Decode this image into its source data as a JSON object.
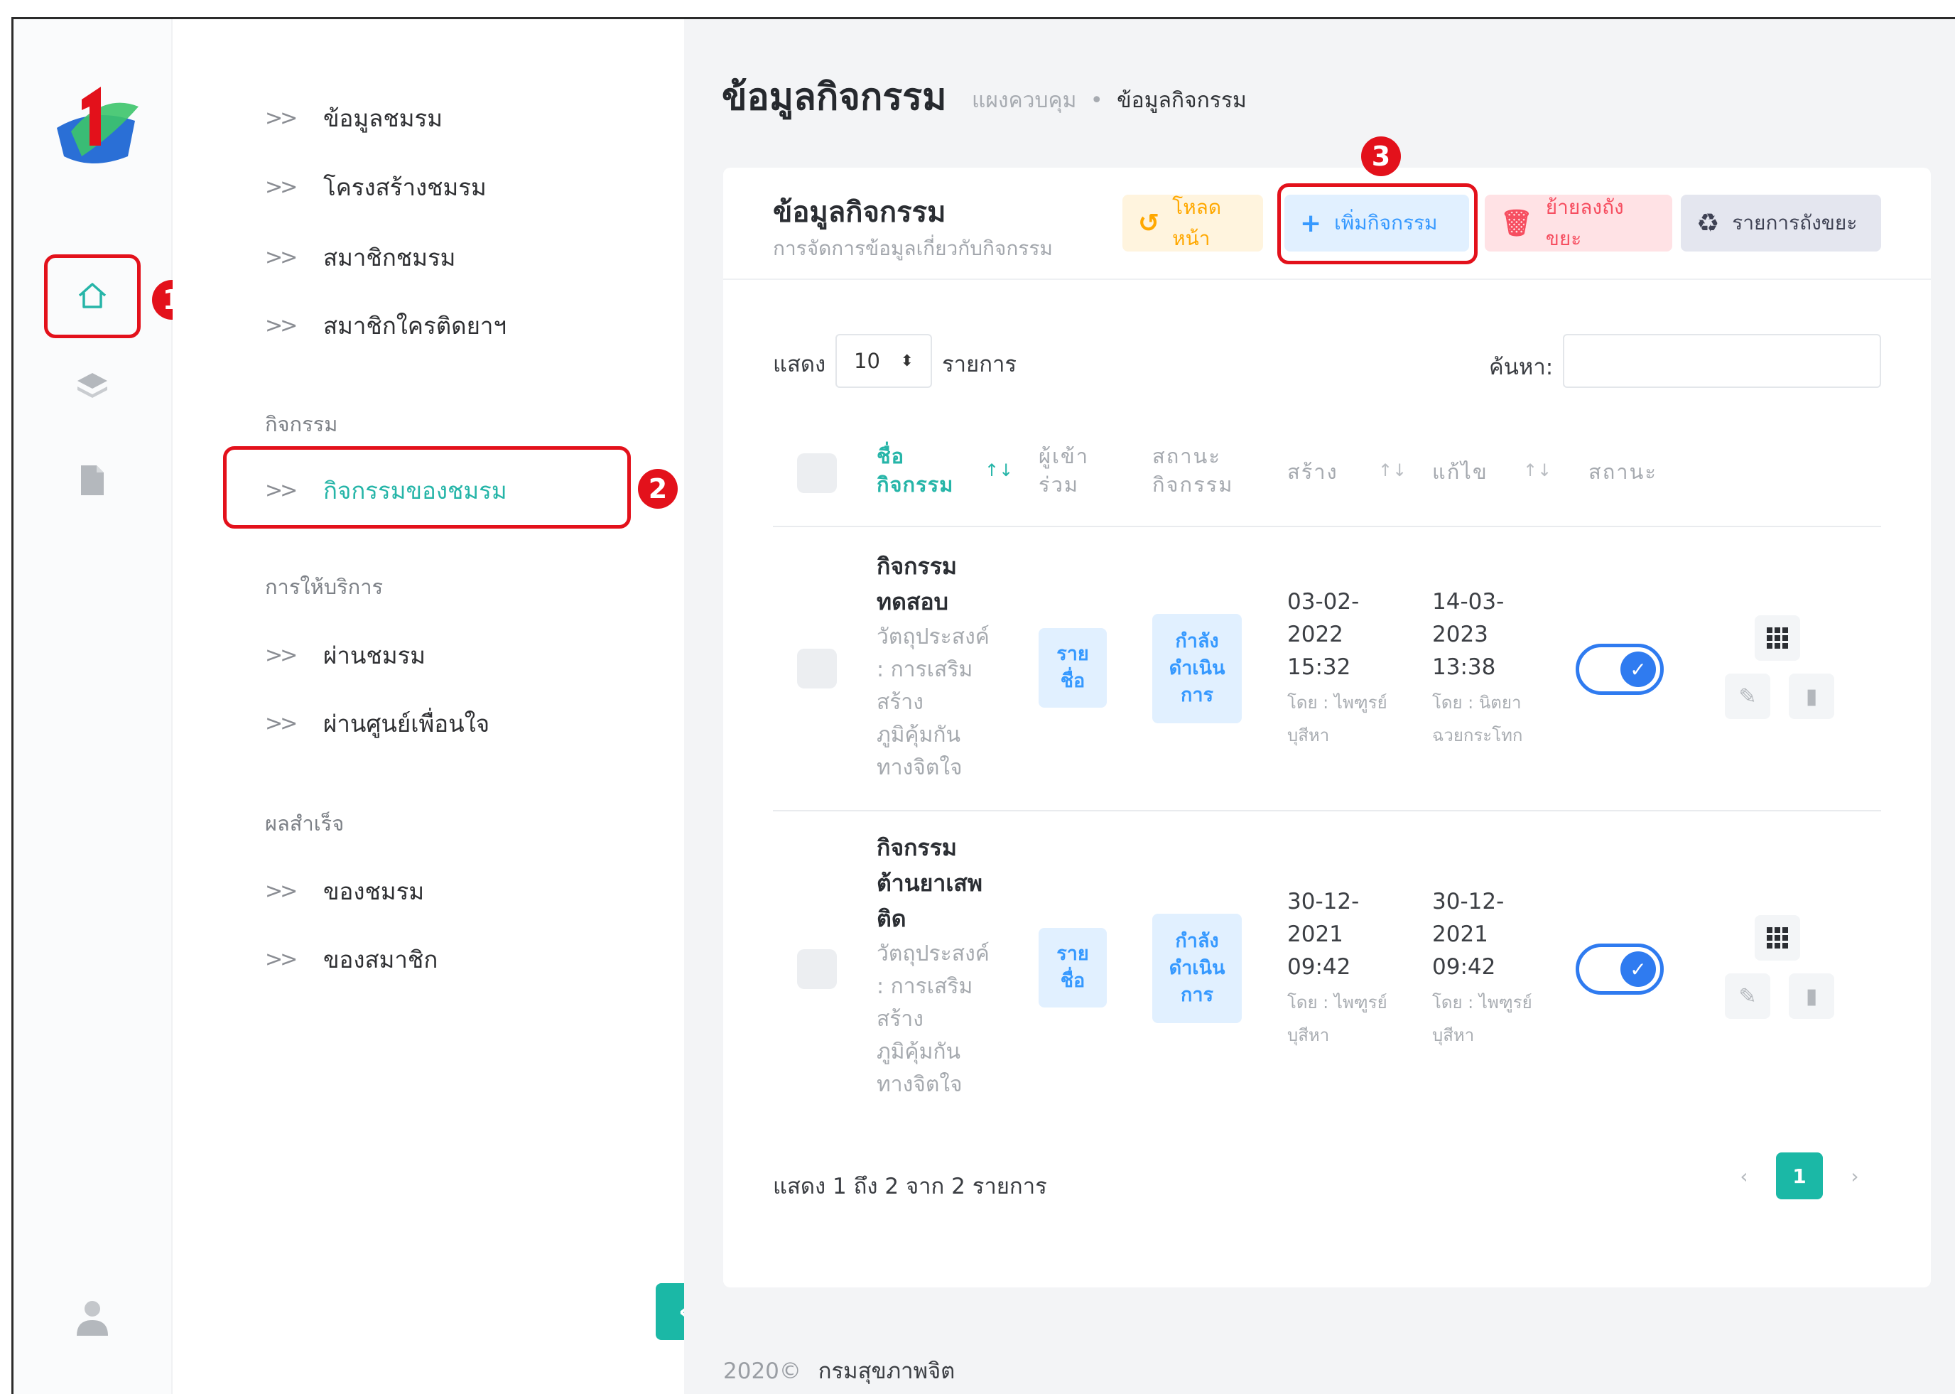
{
  "sidebar_menu": {
    "club_items": [
      "ข้อมูลชมรม",
      "โครงสร้างชมรม",
      "สมาชิกชมรม",
      "สมาชิกใครติดยาฯ"
    ],
    "section_activities": "กิจกรรม",
    "activity_item": "กิจกรรมของชมรม",
    "section_services": "การให้บริการ",
    "service_items": [
      "ผ่านชมรม",
      "ผ่านศูนย์เพื่อนใจ"
    ],
    "section_results": "ผลสำเร็จ",
    "result_items": [
      "ของชมรม",
      "ของสมาชิก"
    ]
  },
  "header": {
    "title": "ข้อมูลกิจกรรม",
    "breadcrumb_home": "แผงควบคุม",
    "breadcrumb_sep": "•",
    "breadcrumb_current": "ข้อมูลกิจกรรม"
  },
  "card": {
    "title": "ข้อมูลกิจกรรม",
    "subtitle": "การจัดการข้อมูลเกี่ยวกับกิจกรรม",
    "btn_reload": "โหลดหน้า",
    "btn_add": "เพิ่มกิจกรรม",
    "btn_trash": "ย้ายลงถังขยะ",
    "btn_trash_list": "รายการถังขยะ"
  },
  "table_controls": {
    "show_label": "แสดง",
    "page_size": "10",
    "items_label": "รายการ",
    "search_label": "ค้นหา:"
  },
  "table_headers": {
    "name": [
      "ชื่อ",
      "กิจกรรม"
    ],
    "participants": [
      "ผู้เข้า",
      "ร่วม"
    ],
    "activity_status": [
      "สถานะ",
      "กิจกรรม"
    ],
    "created": "สร้าง",
    "edited": "แก้ไข",
    "status": "สถานะ"
  },
  "rows": [
    {
      "name": [
        "กิจกรรม",
        "ทดสอบ"
      ],
      "desc": [
        "วัตถุประสงค์",
        ": การเสริม",
        "สร้าง",
        "ภูมิคุ้มกัน",
        "ทางจิตใจ"
      ],
      "participants": [
        "ราย",
        "ชื่อ"
      ],
      "activity_status": [
        "กำลัง",
        "ดำเนิน",
        "การ"
      ],
      "created": [
        "03-02-",
        "2022",
        "15:32"
      ],
      "created_by": [
        "โดย : ไพฑูรย์",
        "บุสีหา"
      ],
      "edited": [
        "14-03-",
        "2023",
        "13:38"
      ],
      "edited_by": [
        "โดย : นิตยา",
        "ฉวยกระโทก"
      ],
      "enabled": true
    },
    {
      "name": [
        "กิจกรรม",
        "ต้านยาเสพ",
        "ติด"
      ],
      "desc": [
        "วัตถุประสงค์",
        ": การเสริม",
        "สร้าง",
        "ภูมิคุ้มกัน",
        "ทางจิตใจ"
      ],
      "participants": [
        "ราย",
        "ชื่อ"
      ],
      "activity_status": [
        "กำลัง",
        "ดำเนิน",
        "การ"
      ],
      "created": [
        "30-12-",
        "2021",
        "09:42"
      ],
      "created_by": [
        "โดย : ไพฑูรย์",
        "บุสีหา"
      ],
      "edited": [
        "30-12-",
        "2021",
        "09:42"
      ],
      "edited_by": [
        "โดย : ไพฑูรย์",
        "บุสีหา"
      ],
      "enabled": true
    }
  ],
  "pagination": {
    "summary": "แสดง 1 ถึง 2 จาก 2 รายการ",
    "prev": "‹",
    "current": "1",
    "next": "›"
  },
  "annotations": [
    "1",
    "2",
    "3"
  ],
  "footer": {
    "copyright": "2020©",
    "org": "กรมสุขภาพจิต"
  },
  "icons": {
    "home": "home-icon",
    "layers": "layers-icon",
    "file": "file-icon",
    "user": "user-icon",
    "reload": "history-icon",
    "add": "plus-icon",
    "trash": "trash-icon",
    "recycle": "recycle-icon",
    "grid": "grid-icon",
    "edit": "pencil-icon",
    "delete": "trash-icon",
    "collapse": "chevron-left-icon"
  },
  "colors": {
    "accent": "#1bb8a6",
    "highlight": "#e3111b",
    "primary": "#3699ff",
    "warning_bg": "#fff4de",
    "warning_text": "#ffa800",
    "danger_bg": "#ffe2e5",
    "danger_text": "#f64e60",
    "dark_bg": "#e4e6ef",
    "dark_text": "#3f4254",
    "toggle": "#2f7bf0"
  }
}
